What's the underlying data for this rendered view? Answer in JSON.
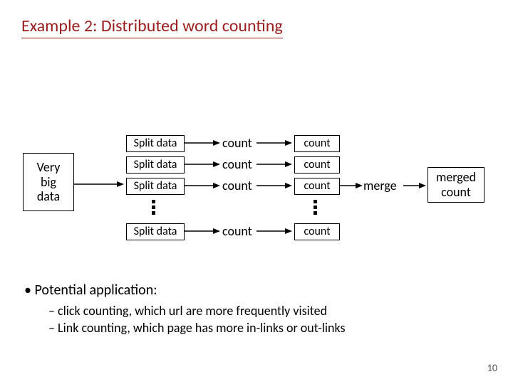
{
  "title": "Example 2: Distributed word counting",
  "source_box": "Very\nbig\ndata",
  "split_label": "Split data",
  "count_label": "count",
  "merge_label": "merge",
  "merged_box": "merged\ncount",
  "bullets": {
    "heading": "Potential application:",
    "items": [
      "click counting, which url are more frequently visited",
      "Link counting, which page has more in-links or out-links"
    ]
  },
  "page_number": "10"
}
